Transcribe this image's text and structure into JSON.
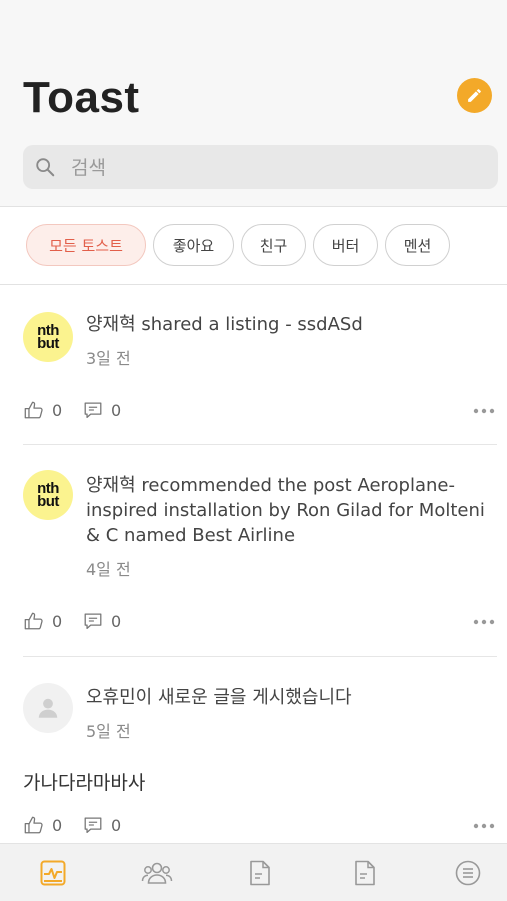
{
  "header": {
    "title": "Toast",
    "search_placeholder": "검색"
  },
  "filters": [
    {
      "label": "모든 토스트",
      "active": true
    },
    {
      "label": "좋아요",
      "active": false
    },
    {
      "label": "친구",
      "active": false
    },
    {
      "label": "버터",
      "active": false
    },
    {
      "label": "멘션",
      "active": false
    }
  ],
  "posts": [
    {
      "avatar_line1": "nth",
      "avatar_line2": "but",
      "text": "양재혁 shared a listing - ssdASd",
      "time": "3일 전",
      "likes": "0",
      "comments": "0"
    },
    {
      "avatar_line1": "nth",
      "avatar_line2": "but",
      "text": "양재혁 recommended the post Aeroplane-inspired installation by Ron Gilad for Molteni & C named Best Airline",
      "time": "4일 전",
      "likes": "0",
      "comments": "0"
    },
    {
      "text": "오휴민이 새로운 글을 게시했습니다",
      "time": "5일 전",
      "body": "가나다라마바사",
      "likes": "0",
      "comments": "0"
    }
  ],
  "colors": {
    "accent": "#f3a929",
    "active_chip_text": "#e25f4a",
    "active_chip_bg": "#fdeeea",
    "avatar_yellow": "#fbf38f"
  },
  "tabbar": {
    "tabs": [
      "activity-icon",
      "friends-icon",
      "document-icon",
      "document-icon",
      "menu-list-icon"
    ],
    "active": 0
  }
}
